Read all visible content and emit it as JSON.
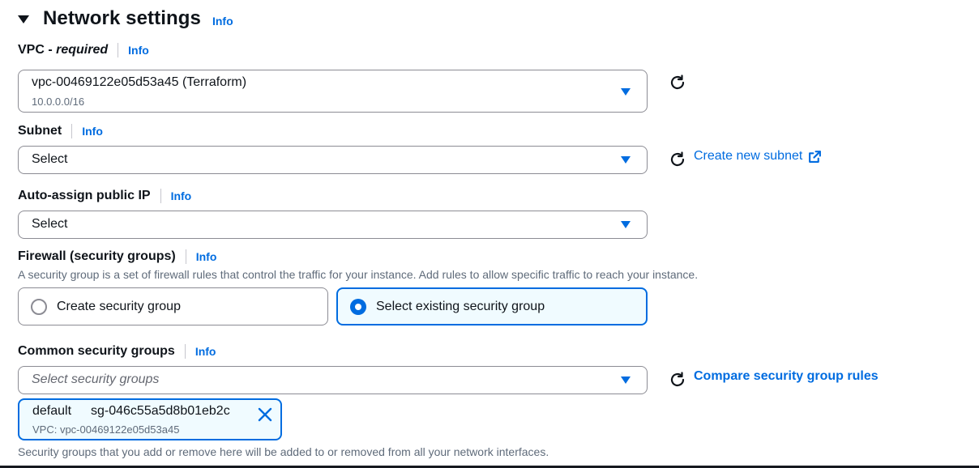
{
  "section": {
    "title": "Network settings",
    "info": "Info"
  },
  "vpc": {
    "label_main": "VPC - ",
    "label_required": "required",
    "info": "Info",
    "value": "vpc-00469122e05d53a45 (Terraform)",
    "sub_value": "10.0.0.0/16"
  },
  "subnet": {
    "label": "Subnet",
    "info": "Info",
    "value": "Select",
    "create_link": "Create new subnet"
  },
  "public_ip": {
    "label": "Auto-assign public IP",
    "info": "Info",
    "value": "Select"
  },
  "firewall": {
    "label": "Firewall (security groups)",
    "info": "Info",
    "description": "A security group is a set of firewall rules that control the traffic for your instance. Add rules to allow specific traffic to reach your instance.",
    "options": [
      {
        "label": "Create security group",
        "selected": false
      },
      {
        "label": "Select existing security group",
        "selected": true
      }
    ]
  },
  "common_sg": {
    "label": "Common security groups",
    "info": "Info",
    "placeholder": "Select security groups",
    "compare_link": "Compare security group rules",
    "token": {
      "name": "default",
      "id": "sg-046c55a5d8b01eb2c",
      "vpc": "VPC: vpc-00469122e05d53a45"
    },
    "footer": "Security groups that you add or remove here will be added to or removed from all your network interfaces."
  },
  "colors": {
    "accent": "#006ce0",
    "selected_bg": "#f0fbff",
    "border": "#8c8c94",
    "text": "#0f141a",
    "muted": "#5f6b7a"
  },
  "icons": [
    "caret-down-icon",
    "refresh-icon",
    "external-link-icon",
    "dropdown-triangle-icon",
    "close-icon"
  ]
}
